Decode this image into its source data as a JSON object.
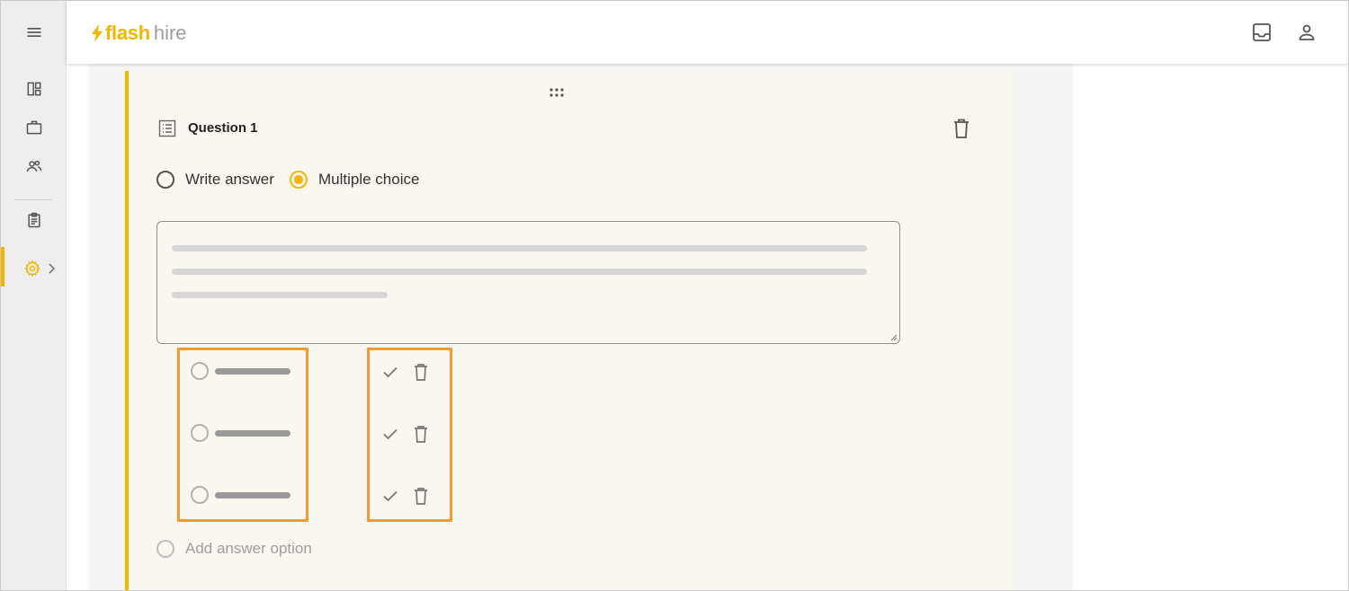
{
  "app": {
    "logo_flash": "flash",
    "logo_hire": "hire",
    "brand_color": "#f4b400",
    "highlight_color": "#f29a33"
  },
  "sidebar": {
    "items": [
      {
        "icon": "menu-icon"
      },
      {
        "icon": "dashboard-icon"
      },
      {
        "icon": "briefcase-icon"
      },
      {
        "icon": "people-icon"
      },
      {
        "icon": "clipboard-icon"
      },
      {
        "icon": "gear-icon",
        "active": true
      }
    ]
  },
  "header": {
    "icons": [
      "inbox-icon",
      "account-icon"
    ]
  },
  "question": {
    "title": "Question 1",
    "answer_types": [
      {
        "label": "Write answer",
        "selected": false
      },
      {
        "label": "Multiple choice",
        "selected": true
      }
    ],
    "options_count": 3,
    "add_option_label": "Add answer option"
  }
}
